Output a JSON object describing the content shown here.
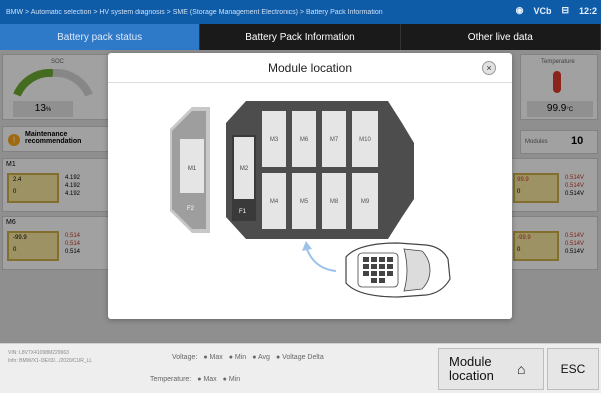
{
  "breadcrumb": "BMW > Automatic selection > HV system diagnosis > SME (Storage Management Electronics) > Battery Pack Information",
  "status": {
    "time": "12:2",
    "vci": "VCb"
  },
  "tabs": [
    {
      "label": "Battery pack status"
    },
    {
      "label": "Battery Pack Information"
    },
    {
      "label": "Other live data"
    }
  ],
  "background": {
    "soc_label": "SOC",
    "soc_value": "13",
    "soc_unit": "%",
    "temperature_label": "Temperature",
    "temperature_value": "99.9",
    "temperature_unit": "°C",
    "maintenance": "Maintenance recommendation",
    "modules_label": "Modules",
    "modules_value": "10",
    "m1": "M1",
    "m6": "M6",
    "m1_values": [
      "2.4",
      "0",
      "4.192",
      "4.192",
      "4.192"
    ],
    "m6_values": [
      "-99.9",
      "0",
      "0.514",
      "0.514",
      "0.514"
    ],
    "right_values": [
      "99.9",
      "0",
      "0.514V",
      "0.514V",
      "0.514V"
    ],
    "right_values_2": [
      "-99.9",
      "0",
      "0.514V",
      "0.514V",
      "0.514V"
    ]
  },
  "modal": {
    "title": "Module location",
    "close": "×",
    "modules_top": [
      "M3",
      "M6",
      "M7",
      "M10"
    ],
    "modules_bottom": [
      "M4",
      "M5",
      "M8",
      "M9"
    ],
    "left_module": "M1",
    "left_label": "F2",
    "main_left_module": "M2",
    "main_left_label": "F1"
  },
  "footer": {
    "vin": "VIN: L8V7X41098M229963",
    "info": "Info: BMW/X1-I3E/I3/.../2020/CUR_LL",
    "voltage_label": "Voltage:",
    "voltage_opts": [
      "Max",
      "Min",
      "Avg",
      "Voltage Delta"
    ],
    "temp_label": "Temperature:",
    "temp_opts": [
      "Max",
      "Min"
    ],
    "module_btn": "Module location",
    "esc": "ESC"
  }
}
